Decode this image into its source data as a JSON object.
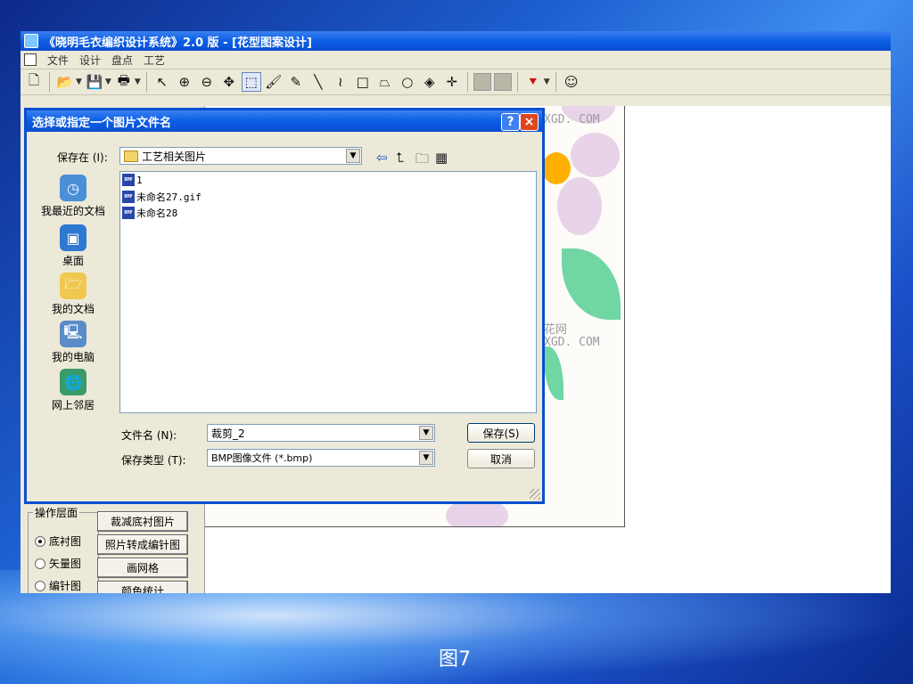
{
  "app": {
    "title": "《晓明毛衣编织设计系统》2.0 版 - [花型图案设计]",
    "menu": [
      "文件",
      "设计",
      "盘点",
      "工艺"
    ],
    "toolbar_icons": [
      "new-file-icon",
      "open-folder-icon",
      "save-icon",
      "print-icon",
      "pointer-icon",
      "zoom-in-icon",
      "zoom-out-icon",
      "move-icon",
      "select-rect-icon",
      "paint-brush-icon",
      "pencil-icon",
      "line-icon",
      "curve-icon",
      "rectangle-icon",
      "polygon-icon",
      "ellipse-icon",
      "fill-icon",
      "crosshair-icon",
      "undo-icon",
      "redo-icon",
      "pin-icon",
      "avatar-icon"
    ]
  },
  "dialog": {
    "title": "选择或指定一个图片文件名",
    "help": "?",
    "close": "×",
    "save_in_label": "保存在 (I):",
    "save_in_value": "工艺相关图片",
    "places": [
      "我最近的文档",
      "桌面",
      "我的文档",
      "我的电脑",
      "网上邻居"
    ],
    "files": [
      "1",
      "未命名27.gif",
      "未命名28"
    ],
    "file_name_label": "文件名 (N):",
    "file_name_value": "裁剪_2",
    "file_type_label": "保存类型 (T):",
    "file_type_value": "BMP图像文件 (*.bmp)",
    "save_button": "保存(S)",
    "cancel_button": "取消"
  },
  "left_panel": {
    "group_title": "操作层面",
    "radios": [
      {
        "label": "底衬图",
        "checked": true
      },
      {
        "label": "矢量图",
        "checked": false
      },
      {
        "label": "编针图",
        "checked": false
      }
    ],
    "buttons": [
      "裁减底衬图片",
      "照片转成编针图",
      "画网格",
      "颜色统计"
    ]
  },
  "canvas": {
    "watermark_1": "XGD. COM",
    "watermark_2": "花网",
    "watermark_3": "XGD. COM"
  },
  "caption": "图7",
  "colors": {
    "title_bar": "#0b5ee5",
    "petal": "#e8d3e8",
    "leaf": "#6fd6a4",
    "flower_center": "#ffb000"
  }
}
